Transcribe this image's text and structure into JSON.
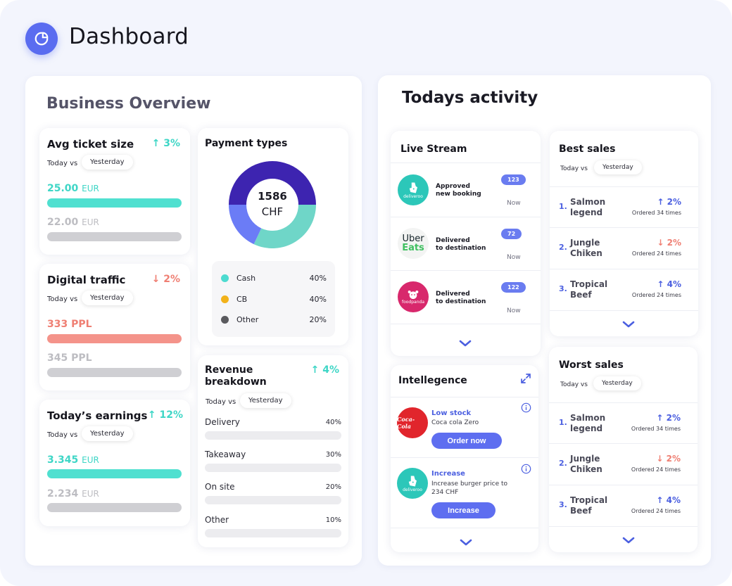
{
  "app": {
    "title": "Dashboard"
  },
  "overview": {
    "title": "Business Overview",
    "avg_ticket": {
      "title": "Avg ticket size",
      "delta": "3%",
      "today_vs": "Today vs",
      "pill": "Yesterday",
      "current_value": "25.00",
      "current_unit": "EUR",
      "previous_value": "22.00",
      "previous_unit": "EUR"
    },
    "digital_traffic": {
      "title": "Digital traffic",
      "delta": "2%",
      "today_vs": "Today vs",
      "pill": "Yesterday",
      "current_value": "333 PPL",
      "previous_value": "345 PPL"
    },
    "earnings": {
      "title": "Today’s earnings",
      "delta": "12%",
      "today_vs": "Today vs",
      "pill": "Yesterday",
      "current_value": "3.345",
      "current_unit": "EUR",
      "previous_value": "2.234",
      "previous_unit": "EUR"
    },
    "payment_types": {
      "title": "Payment types",
      "center_value": "1586",
      "center_unit": "CHF",
      "legend": [
        {
          "label": "Cash",
          "percent": "40%",
          "color": "#4ddbd0"
        },
        {
          "label": "CB",
          "percent": "40%",
          "color": "#f2b21a"
        },
        {
          "label": "Other",
          "percent": "20%",
          "color": "#5a5a5e"
        }
      ],
      "donut_colors": [
        "#3d24b0",
        "#6fd6c8",
        "#6b7cf6"
      ],
      "donut_shares": [
        0.5,
        0.32,
        0.18
      ]
    },
    "revenue": {
      "title_line1": "Revenue",
      "title_line2": "breakdown",
      "delta": "4%",
      "today_vs": "Today vs",
      "pill": "Yesterday",
      "rows": [
        {
          "label": "Delivery",
          "percent": "40%"
        },
        {
          "label": "Takeaway",
          "percent": "30%"
        },
        {
          "label": "On site",
          "percent": "20%"
        },
        {
          "label": "Other",
          "percent": "10%"
        }
      ]
    }
  },
  "activity": {
    "title": "Todays activity",
    "live_stream": {
      "title": "Live Stream",
      "items": [
        {
          "brand": "deliveroo",
          "line1": "Approved",
          "line2": "new booking",
          "badge": "123",
          "time": "Now"
        },
        {
          "brand_line1": "Uber",
          "brand_line2": "Eats",
          "line1": "Delivered",
          "line2": "to destination",
          "badge": "72",
          "time": "Now"
        },
        {
          "brand": "foodpanda",
          "line1": "Delivered",
          "line2": "to destination",
          "badge": "122",
          "time": "Now"
        }
      ]
    },
    "intelligence": {
      "title": "Intellegence",
      "items": [
        {
          "brand": "Coca-Cola",
          "heading": "Low stock",
          "text": "Coca cola Zero",
          "button": "Order now"
        },
        {
          "brand": "deliveroo",
          "heading": "Increase",
          "text_line1": "Increase burger price to",
          "text_line2": "234 CHF",
          "button": "Increase"
        }
      ]
    },
    "best_sales": {
      "title": "Best sales",
      "today_vs": "Today vs",
      "pill": "Yesterday",
      "items": [
        {
          "rank": "1.",
          "name_line1": "Salmon",
          "name_line2": "legend",
          "delta": "2%",
          "ordered": "Ordered 34 times",
          "trend": "up"
        },
        {
          "rank": "2.",
          "name_line1": "Jungle",
          "name_line2": "Chiken",
          "delta": "2%",
          "ordered": "Ordered 24 times",
          "trend": "down"
        },
        {
          "rank": "3.",
          "name_line1": "Tropical",
          "name_line2": "Beef",
          "delta": "4%",
          "ordered": "Ordered 24 times",
          "trend": "up"
        }
      ]
    },
    "worst_sales": {
      "title": "Worst sales",
      "today_vs": "Today vs",
      "pill": "Yesterday",
      "items": [
        {
          "rank": "1.",
          "name_line1": "Salmon",
          "name_line2": "legend",
          "delta": "2%",
          "ordered": "Ordered 34 times",
          "trend": "up"
        },
        {
          "rank": "2.",
          "name_line1": "Jungle",
          "name_line2": "Chiken",
          "delta": "2%",
          "ordered": "Ordered 24 times",
          "trend": "down"
        },
        {
          "rank": "3.",
          "name_line1": "Tropical",
          "name_line2": "Beef",
          "delta": "4%",
          "ordered": "Ordered 24 times",
          "trend": "up"
        }
      ]
    }
  }
}
